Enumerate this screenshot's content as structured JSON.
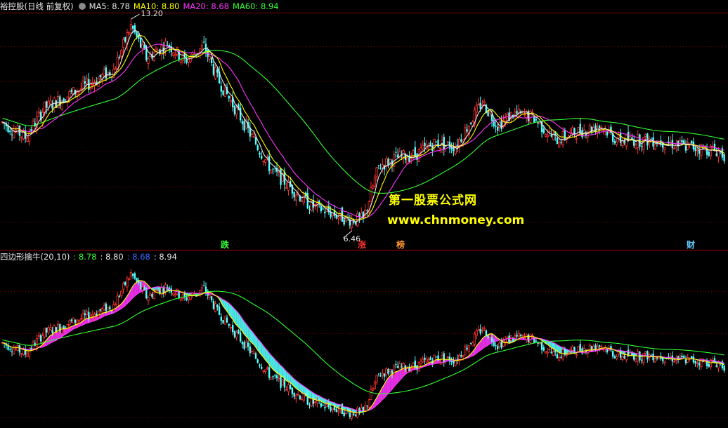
{
  "upper_panel": {
    "title": "裕控股(日线 前复权)",
    "ma_labels": [
      {
        "text": "MA5: 8.78",
        "color": "#e6e6e6"
      },
      {
        "text": "MA10: 8.80",
        "color": "#ffff00"
      },
      {
        "text": "MA20: 8.68",
        "color": "#ff33ff"
      },
      {
        "text": "MA60: 8.94",
        "color": "#33ff33"
      }
    ],
    "high_label": "13.20",
    "low_label": "6.46",
    "event_tags": [
      {
        "text": "跌",
        "color": "#33ff33"
      },
      {
        "text": "涨",
        "color": "#ff3333"
      },
      {
        "text": "榜",
        "color": "#ff9933"
      },
      {
        "text": "财",
        "color": "#66ccff"
      }
    ]
  },
  "lower_panel": {
    "title": "四边形擒牛(20,10)",
    "values": [
      {
        "text": ": 8.78",
        "color": "#33ff33"
      },
      {
        "text": ": 8.80",
        "color": "#e6e6e6"
      },
      {
        "text": ": 8.68",
        "color": "#3366ff"
      },
      {
        "text": ": 8.94",
        "color": "#e6e6e6"
      }
    ]
  },
  "watermark": {
    "line1": "第一股票公式网",
    "line2": "www.chnmoney.com"
  },
  "colors": {
    "up": "#ff3333",
    "down": "#54ffff",
    "ma5": "#e6e6e6",
    "ma10": "#ffff00",
    "ma20": "#ff33ff",
    "ma60": "#33ff33",
    "grid": "#7a0000",
    "band_up": "#ff33ff",
    "band_down": "#54ffff"
  },
  "chart_data": {
    "type": "candlestick",
    "ylim": [
      6.0,
      13.6
    ],
    "anchors": [
      [
        0,
        9.9
      ],
      [
        12,
        9.4
      ],
      [
        22,
        10.4
      ],
      [
        42,
        11.1
      ],
      [
        58,
        11.7
      ],
      [
        67,
        13.2
      ],
      [
        75,
        12.1
      ],
      [
        86,
        12.6
      ],
      [
        95,
        12.0
      ],
      [
        105,
        12.5
      ],
      [
        112,
        11.4
      ],
      [
        140,
        8.3
      ],
      [
        160,
        7.1
      ],
      [
        180,
        6.6
      ],
      [
        188,
        6.6
      ],
      [
        196,
        8.4
      ],
      [
        205,
        8.7
      ],
      [
        215,
        8.8
      ],
      [
        225,
        9.2
      ],
      [
        236,
        9.1
      ],
      [
        250,
        10.6
      ],
      [
        258,
        9.8
      ],
      [
        266,
        10.2
      ],
      [
        276,
        10.1
      ],
      [
        288,
        9.3
      ],
      [
        300,
        9.6
      ],
      [
        312,
        9.8
      ],
      [
        320,
        9.3
      ],
      [
        340,
        9.3
      ],
      [
        355,
        9.1
      ],
      [
        372,
        8.95
      ],
      [
        376,
        8.8
      ]
    ]
  }
}
